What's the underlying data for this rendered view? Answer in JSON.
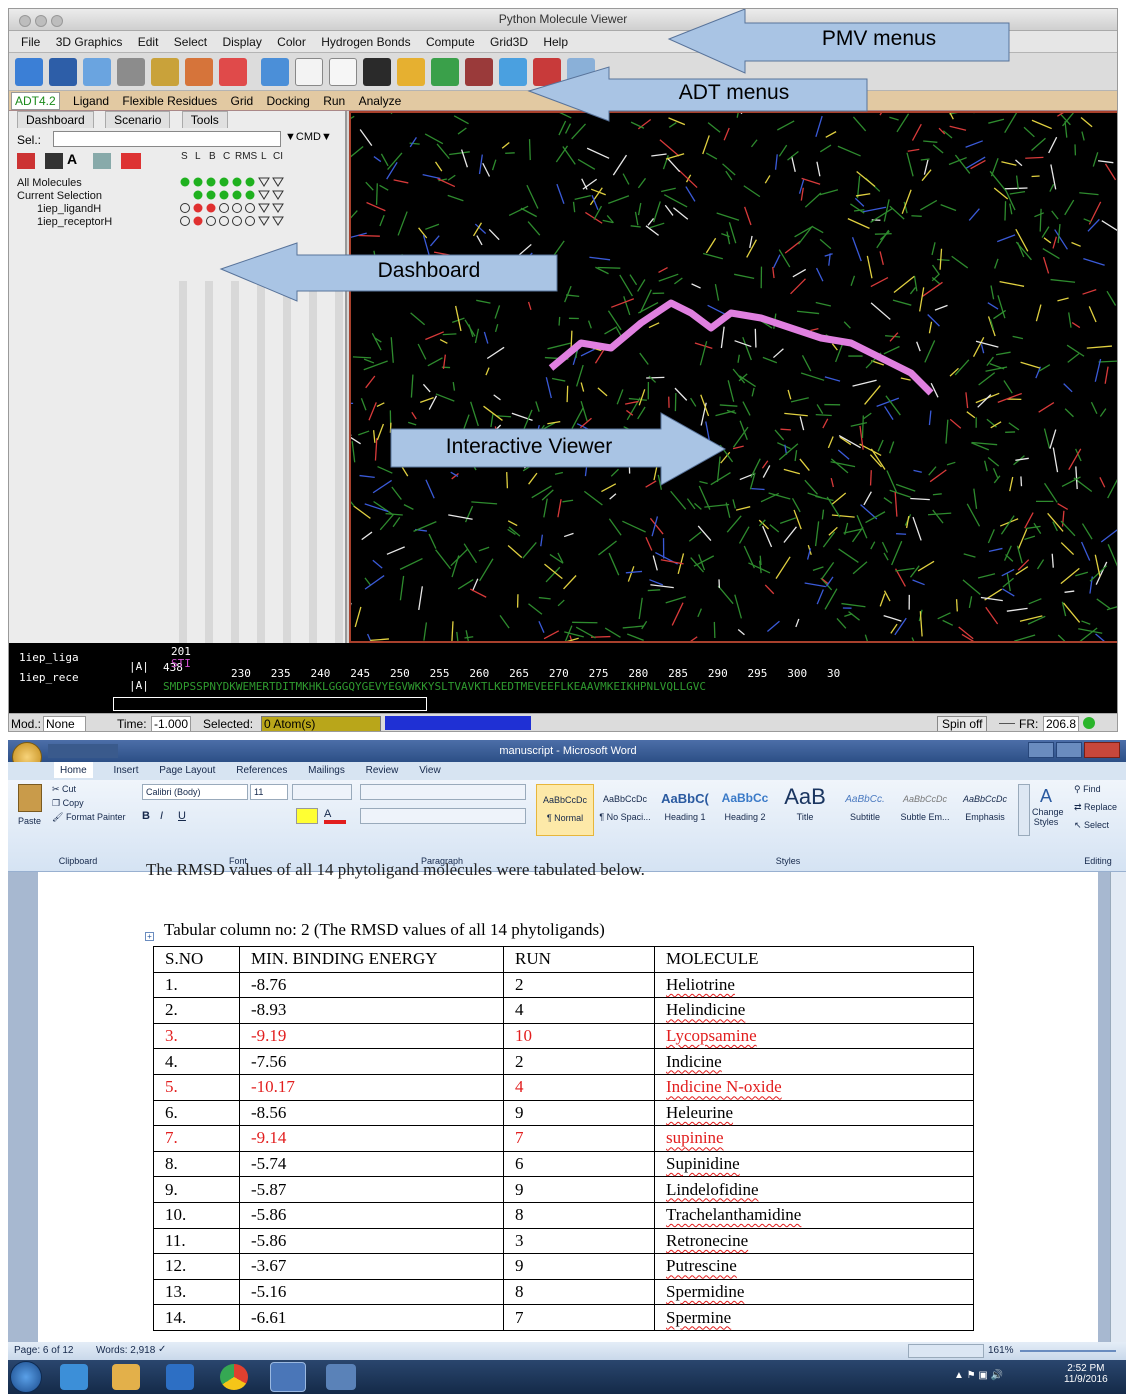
{
  "pmv": {
    "window_title": "Python Molecule Viewer",
    "menus": [
      "File",
      "3D Graphics",
      "Edit",
      "Select",
      "Display",
      "Color",
      "Hydrogen Bonds",
      "Compute",
      "Grid3D",
      "Help"
    ],
    "adt_version": "ADT4.2",
    "adt_menus": [
      "Ligand",
      "Flexible Residues",
      "Grid",
      "Docking",
      "Run",
      "Analyze"
    ],
    "dashboard_tabs": [
      "Dashboard",
      "Scenario",
      "Tools"
    ],
    "sel_label": "Sel.:",
    "cmd_label": "CMD",
    "col_heads": [
      "S",
      "L",
      "B",
      "C",
      "RMS",
      "L",
      "CI"
    ],
    "rows": [
      "All Molecules",
      "Current Selection",
      "1iep_ligandH",
      "1iep_receptorH"
    ],
    "seq": {
      "name1": "1iep_liga",
      "name2": "1iep_rece",
      "chain": "|A|",
      "num_top": "201",
      "num_left": "438",
      "res1": "STI",
      "ticks": "230   235   240   245   250   255   260   265   270   275   280   285   290   295   300   30",
      "sequence": "SMDPSSPNYDKWEMERTDITMKHKLGGGQYGEVYEGVWKKYSLTVAVKTLKEDTMEVEEFLKEAAVMKEIKHPNLVQLLGVC"
    },
    "status": {
      "mod_label": "Mod.:",
      "mod_value": "None",
      "time_label": "Time:",
      "time_value": "-1.000",
      "selected_label": "Selected:",
      "selected_value": "0 Atom(s)",
      "spin": "Spin off",
      "fr_label": "FR:",
      "fr_value": "206.8"
    }
  },
  "callouts": {
    "pmv_menus": "PMV menus",
    "adt_menus": "ADT menus",
    "dashboard": "Dashboard",
    "viewer": "Interactive Viewer"
  },
  "word": {
    "title": "manuscript - Microsoft Word",
    "tabs": [
      "Home",
      "Insert",
      "Page Layout",
      "References",
      "Mailings",
      "Review",
      "View"
    ],
    "clipboard": {
      "cut": "Cut",
      "copy": "Copy",
      "paste": "Paste",
      "format_painter": "Format Painter",
      "group": "Clipboard"
    },
    "font": {
      "name": "Calibri (Body)",
      "size": "11",
      "group": "Font"
    },
    "paragraph_group": "Paragraph",
    "styles": [
      {
        "sample": "AaBbCcDc",
        "name": "¶ Normal"
      },
      {
        "sample": "AaBbCcDc",
        "name": "¶ No Spaci..."
      },
      {
        "sample": "AaBbC(",
        "name": "Heading 1"
      },
      {
        "sample": "AaBbCc",
        "name": "Heading 2"
      },
      {
        "sample": "AaB",
        "name": "Title"
      },
      {
        "sample": "AaBbCc.",
        "name": "Subtitle"
      },
      {
        "sample": "AaBbCcDc",
        "name": "Subtle Em..."
      },
      {
        "sample": "AaBbCcDc",
        "name": "Emphasis"
      }
    ],
    "styles_group": "Styles",
    "change_styles": "Change Styles",
    "editing": {
      "find": "Find",
      "replace": "Replace",
      "select": "Select",
      "group": "Editing"
    },
    "intro_text": "The RMSD values of all 14 phytoligand molecules were tabulated below.",
    "caption": "Tabular column no: 2 (The RMSD values of all 14 phytoligands)",
    "table": {
      "headers": [
        "S.NO",
        "MIN. BINDING ENERGY",
        "RUN",
        "MOLECULE"
      ],
      "rows": [
        [
          "1.",
          "-8.76",
          "2",
          "Heliotrine"
        ],
        [
          "2.",
          "-8.93",
          "4",
          "Helindicine"
        ],
        [
          "3.",
          "-9.19",
          "10",
          "Lycopsamine"
        ],
        [
          "4.",
          "-7.56",
          "2",
          "Indicine"
        ],
        [
          "5.",
          "-10.17",
          "4",
          "Indicine N-oxide"
        ],
        [
          "6.",
          "-8.56",
          "9",
          "Heleurine"
        ],
        [
          "7.",
          "-9.14",
          "7",
          "supinine"
        ],
        [
          "8.",
          "-5.74",
          "6",
          "Supinidine"
        ],
        [
          "9.",
          "-5.87",
          "9",
          "Lindelofidine"
        ],
        [
          "10.",
          "-5.86",
          "8",
          "Trachelanthamidine"
        ],
        [
          "11.",
          "-5.86",
          "3",
          "Retronecine"
        ],
        [
          "12.",
          "-3.67",
          "9",
          "Putrescine"
        ],
        [
          "13.",
          "-5.16",
          "8",
          "Spermidine"
        ],
        [
          "14.",
          "-6.61",
          "7",
          "Spermine"
        ]
      ],
      "highlight_rows": [
        2,
        4,
        6
      ],
      "highlight_color": "#e21e1e"
    },
    "status": {
      "page": "Page: 6 of 12",
      "words": "Words: 2,918",
      "zoom": "161%"
    },
    "clock": {
      "time": "2:52 PM",
      "date": "11/9/2016"
    }
  }
}
